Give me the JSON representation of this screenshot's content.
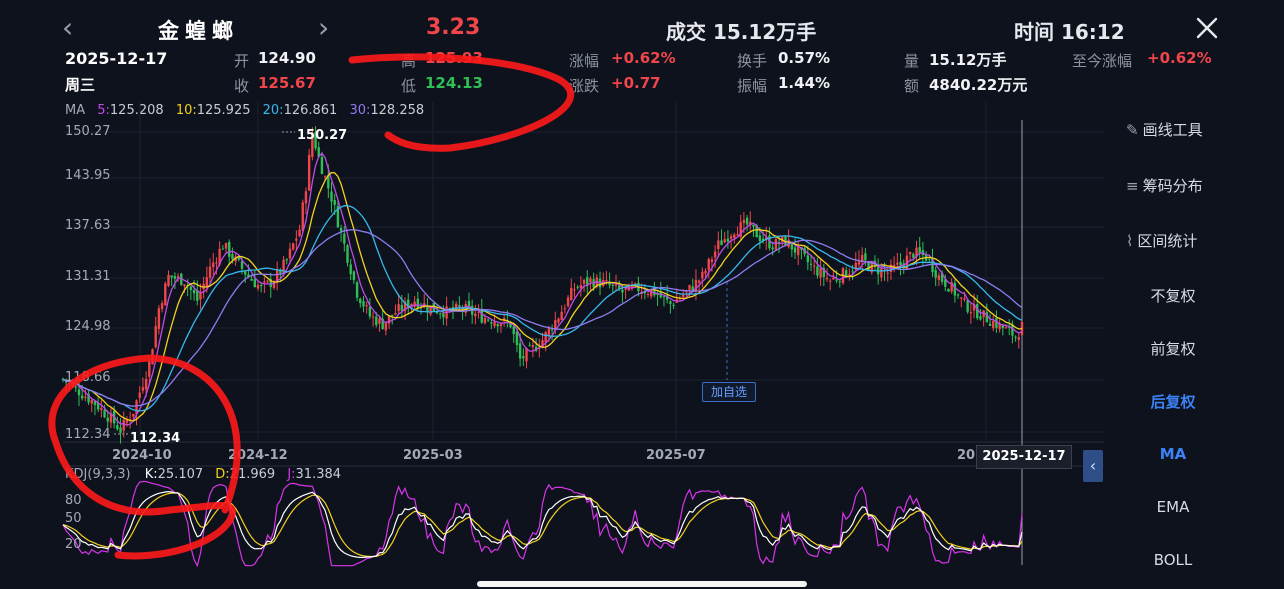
{
  "header": {
    "stock_name": "金蝗螂",
    "price": "3.23",
    "volume_text": "成交 15.12万手",
    "time_text": "时间 16:12"
  },
  "quote": {
    "date": "2025-12-17",
    "weekday": "周三",
    "open_label": "开",
    "open": "124.90",
    "close_label": "收",
    "close": "125.67",
    "high_label": "高",
    "high": "125.93",
    "low_label": "低",
    "low": "124.13",
    "change_pct_label": "涨幅",
    "change_pct": "+0.62%",
    "change_label": "涨跌",
    "change": "+0.77",
    "turnover_label": "换手",
    "turnover": "0.57%",
    "amplitude_label": "振幅",
    "amplitude": "1.44%",
    "volume_label": "量",
    "volume": "15.12万手",
    "amount_label": "额",
    "amount": "4840.22万元",
    "ytd_label": "至今涨幅",
    "ytd": "+0.62%"
  },
  "ma": {
    "label": "MA",
    "items": [
      {
        "key": "5:",
        "value": "125.208",
        "color": "#c04be6"
      },
      {
        "key": "10:",
        "value": "125.925",
        "color": "#f2d21f"
      },
      {
        "key": "20:",
        "value": "126.861",
        "color": "#38b8ec"
      },
      {
        "key": "30:",
        "value": "128.258",
        "color": "#8f7cf0"
      }
    ]
  },
  "kdj": {
    "label": "KDJ(9,3,3)",
    "k_label": "K:",
    "k": "25.107",
    "d_label": "D:",
    "d": "21.969",
    "j_label": "J:",
    "j": "31.384",
    "k_color": "#ffffff",
    "d_color": "#f2d21f",
    "j_color": "#d635e8",
    "levels": [
      "80",
      "50",
      "20"
    ]
  },
  "price_axis": [
    "150.27",
    "143.95",
    "137.63",
    "131.31",
    "124.98",
    "118.66",
    "112.34"
  ],
  "x_axis": [
    "2024-10",
    "2024-12",
    "2025-03",
    "2025-07",
    "20"
  ],
  "annotations": {
    "max_label": "150.27",
    "min_label": "112.34",
    "cursor_date": "2025-12-17",
    "watchlist_tag": "加自选"
  },
  "sidebar": {
    "tools": [
      {
        "icon": "pen-icon",
        "label": "画线工具"
      },
      {
        "icon": "chip-distribution-icon",
        "label": "筹码分布"
      },
      {
        "icon": "range-stat-icon",
        "label": "区间统计"
      }
    ],
    "adjust": [
      "不复权",
      "前复权",
      "后复权"
    ],
    "active_adjust": "后复权",
    "indicators": [
      "MA",
      "EMA",
      "BOLL"
    ],
    "active_indicator": "MA"
  },
  "colors": {
    "up": "#f0464b",
    "down": "#2fbf56",
    "accent": "#3b82f6",
    "background": "#0e121d",
    "annotation": "#ff1a1a"
  },
  "chart_data": {
    "type": "candlestick",
    "ylim": [
      112.34,
      150.27
    ],
    "x_ticks": [
      "2024-10",
      "2024-12",
      "2025-03",
      "2025-07"
    ],
    "ma_series": [
      "MA5",
      "MA10",
      "MA20",
      "MA30"
    ],
    "close_path": [
      [
        0,
        119
      ],
      [
        5,
        117.5
      ],
      [
        10,
        116
      ],
      [
        15,
        114
      ],
      [
        18,
        112.6
      ],
      [
        22,
        115
      ],
      [
        27,
        121
      ],
      [
        30,
        128
      ],
      [
        33,
        132
      ],
      [
        38,
        131.5
      ],
      [
        42,
        129
      ],
      [
        46,
        133
      ],
      [
        50,
        136
      ],
      [
        54,
        134
      ],
      [
        58,
        132
      ],
      [
        62,
        130.5
      ],
      [
        66,
        131.5
      ],
      [
        70,
        134
      ],
      [
        74,
        138
      ],
      [
        76,
        143.5
      ],
      [
        78,
        150.27
      ],
      [
        80,
        147
      ],
      [
        84,
        142
      ],
      [
        88,
        136
      ],
      [
        92,
        130
      ],
      [
        96,
        127
      ],
      [
        100,
        126
      ],
      [
        104,
        127.5
      ],
      [
        110,
        129
      ],
      [
        115,
        128
      ],
      [
        120,
        127.5
      ],
      [
        125,
        128
      ],
      [
        130,
        127
      ],
      [
        135,
        126.5
      ],
      [
        140,
        126
      ],
      [
        143,
        121.5
      ],
      [
        146,
        122.5
      ],
      [
        150,
        124
      ],
      [
        155,
        127
      ],
      [
        160,
        130.5
      ],
      [
        165,
        131.5
      ],
      [
        170,
        131
      ],
      [
        175,
        130
      ],
      [
        180,
        130.5
      ],
      [
        185,
        130
      ],
      [
        190,
        128.5
      ],
      [
        195,
        130
      ],
      [
        200,
        132
      ],
      [
        205,
        136
      ],
      [
        210,
        138
      ],
      [
        214,
        138.5
      ],
      [
        218,
        137
      ],
      [
        222,
        136
      ],
      [
        226,
        136.5
      ],
      [
        230,
        135
      ],
      [
        235,
        133
      ],
      [
        240,
        131.5
      ],
      [
        245,
        132.5
      ],
      [
        250,
        134
      ],
      [
        254,
        133
      ],
      [
        258,
        132.5
      ],
      [
        262,
        133.5
      ],
      [
        266,
        135
      ],
      [
        270,
        134.5
      ],
      [
        274,
        132
      ],
      [
        278,
        130.5
      ],
      [
        282,
        128.5
      ],
      [
        286,
        127.5
      ],
      [
        290,
        126.5
      ],
      [
        294,
        125.5
      ],
      [
        298,
        124.5
      ],
      [
        300,
        125.7
      ]
    ]
  }
}
